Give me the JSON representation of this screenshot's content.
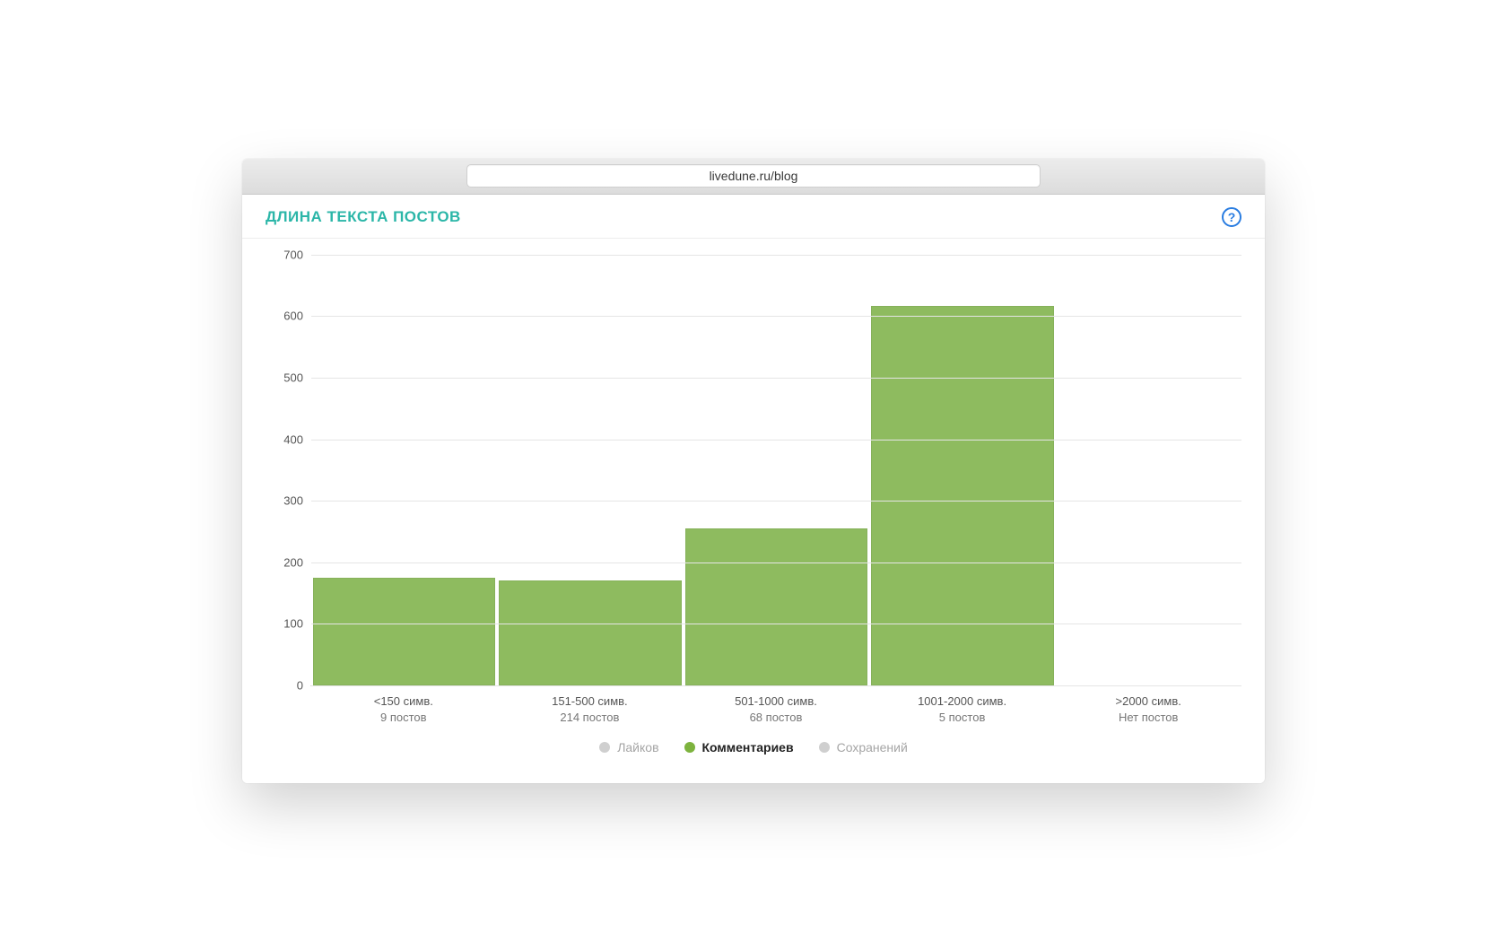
{
  "browser": {
    "url": "livedune.ru/blog"
  },
  "card": {
    "title": "ДЛИНА ТЕКСТА ПОСТОВ",
    "help_tooltip": "?"
  },
  "legend": {
    "items": [
      {
        "label": "Лайков",
        "active": false
      },
      {
        "label": "Комментариев",
        "active": true
      },
      {
        "label": "Сохранений",
        "active": false
      }
    ]
  },
  "chart_data": {
    "type": "bar",
    "title": "ДЛИНА ТЕКСТА ПОСТОВ",
    "xlabel": "",
    "ylabel": "",
    "ylim": [
      0,
      700
    ],
    "yticks": [
      0,
      100,
      200,
      300,
      400,
      500,
      600,
      700
    ],
    "categories": [
      {
        "range": "<150 симв.",
        "posts": "9 постов"
      },
      {
        "range": "151-500 симв.",
        "posts": "214 постов"
      },
      {
        "range": "501-1000 симв.",
        "posts": "68 постов"
      },
      {
        "range": "1001-2000 симв.",
        "posts": "5 постов"
      },
      {
        "range": ">2000 симв.",
        "posts": "Нет постов"
      }
    ],
    "series": [
      {
        "name": "Комментариев",
        "values": [
          175,
          170,
          255,
          617,
          0
        ],
        "color": "#8ebb5f"
      }
    ]
  }
}
